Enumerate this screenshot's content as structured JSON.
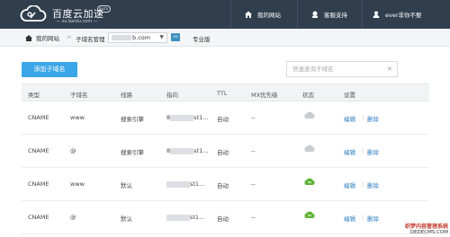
{
  "brand": {
    "title": "百度云加速",
    "subtitle": "— su.baidu.com —",
    "badge": "beta"
  },
  "nav": {
    "home": "我的网站",
    "support": "客服支持",
    "user": "ever非你不娶"
  },
  "breadcrumb": {
    "home": "我的网站",
    "arrow": ">",
    "section": "子域名管理",
    "domain_suffix": "b.com",
    "domain_caret": "▼",
    "ns_badge": "ns",
    "plan": "专业版"
  },
  "toolbar": {
    "add_button": "添加子域名",
    "search_placeholder": "快速查询子域名",
    "clear": "✕"
  },
  "table": {
    "headers": {
      "type": "类型",
      "subdomain": "子域名",
      "line": "线路",
      "pointer": "指向",
      "ttl": "TTL",
      "mx": "MX优先级",
      "status": "状态",
      "settings": "设置"
    },
    "rows": [
      {
        "type": "CNAME",
        "subdomain": "www",
        "line": "搜索引擎",
        "pointer_prefix": "8",
        "pointer_suffix": "st1...",
        "ttl": "自动",
        "mx": "--",
        "status": "gray-cloud",
        "edit": "编辑",
        "delete": "删除"
      },
      {
        "type": "CNAME",
        "subdomain": "@",
        "line": "搜索引擎",
        "pointer_prefix": "8",
        "pointer_suffix": "st1...",
        "ttl": "自动",
        "mx": "--",
        "status": "gray-cloud",
        "edit": "编辑",
        "delete": "删除"
      },
      {
        "type": "CNAME",
        "subdomain": "www",
        "line": "默认",
        "pointer_prefix": "",
        "pointer_suffix": "st1...",
        "ttl": "自动",
        "mx": "--",
        "status": "green-cloud",
        "edit": "编辑",
        "delete": "删除"
      },
      {
        "type": "CNAME",
        "subdomain": "@",
        "line": "默认",
        "pointer_prefix": "",
        "pointer_suffix": "st1...",
        "ttl": "自动",
        "mx": "--",
        "status": "green-cloud",
        "edit": "编辑",
        "delete": "删除"
      }
    ],
    "op_sep": "|"
  },
  "watermark": {
    "line1": "织梦内容管理系统",
    "line2": "DEDECMS.COM"
  },
  "colors": {
    "topbar": "#313e4e",
    "accent": "#3ba6e8",
    "link": "#2f7fc1",
    "cloud_on": "#5fb336",
    "cloud_off": "#c9ccd0"
  }
}
